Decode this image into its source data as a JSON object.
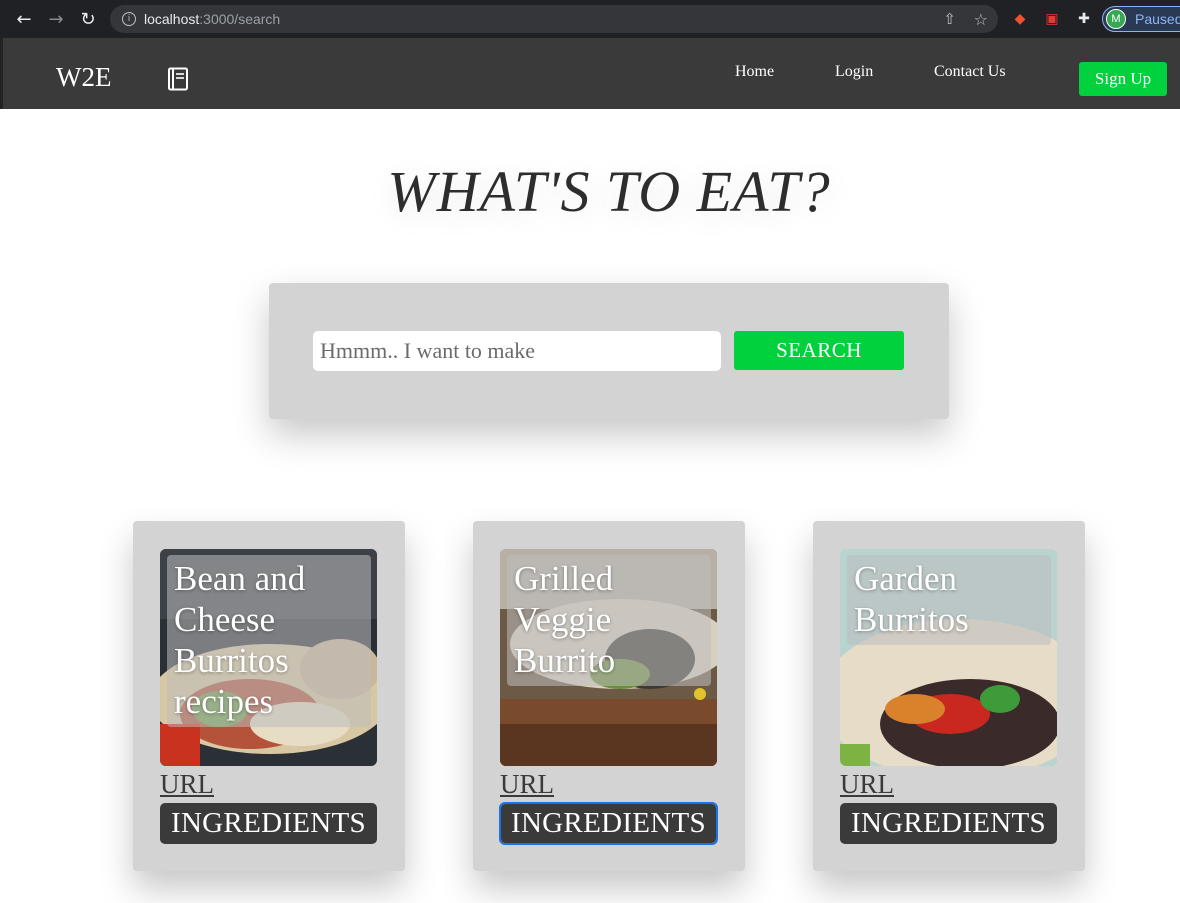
{
  "browser": {
    "url_host": "localhost",
    "url_path": ":3000/search",
    "profile_initial": "M",
    "profile_status": "Paused"
  },
  "nav": {
    "brand": "W2E",
    "links": [
      "Home",
      "Login",
      "Contact Us"
    ],
    "signup": "Sign Up"
  },
  "hero": {
    "title": "WHAT'S TO EAT?"
  },
  "search": {
    "placeholder": "Hmmm.. I want to make",
    "button": "SEARCH"
  },
  "results": [
    {
      "title": "Bean and Cheese Burritos recipes",
      "url_label": "URL",
      "ingredients_label": "INGREDIENTS"
    },
    {
      "title": "Grilled Veggie Burrito",
      "url_label": "URL",
      "ingredients_label": "INGREDIENTS"
    },
    {
      "title": "Garden Burritos",
      "url_label": "URL",
      "ingredients_label": "INGREDIENTS"
    }
  ],
  "colors": {
    "navbar": "#3a3a3a",
    "accent_green": "#00d13c",
    "panel_gray": "#d3d3d3",
    "button_dark": "#3a3a3a"
  },
  "icons": [
    "back-arrow-icon",
    "forward-arrow-icon",
    "reload-icon",
    "info-icon",
    "share-icon",
    "star-icon",
    "extension-puzzle-icon",
    "notebook-icon"
  ]
}
